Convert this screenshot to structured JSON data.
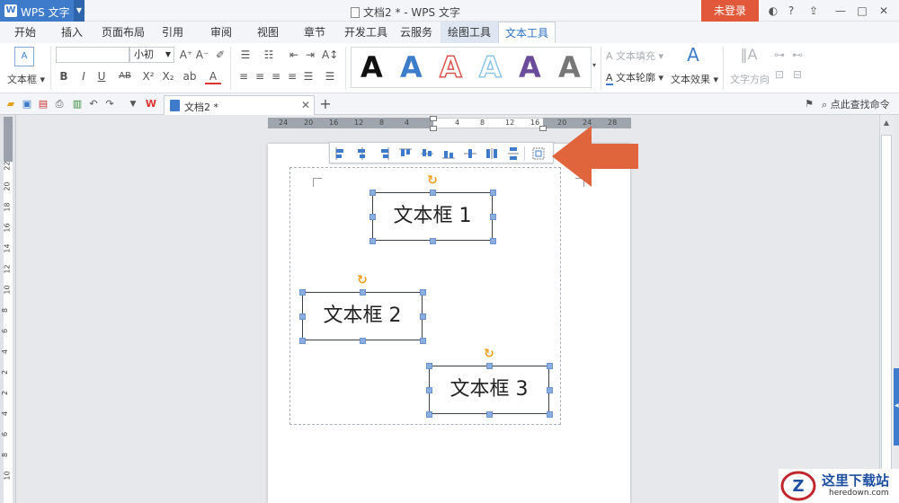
{
  "app": {
    "name": "WPS 文字",
    "doc_title": "文档2 * - WPS 文字",
    "login_label": "未登录"
  },
  "tabs": [
    "开始",
    "插入",
    "页面布局",
    "引用",
    "审阅",
    "视图",
    "章节",
    "开发工具",
    "云服务",
    "绘图工具",
    "文本工具"
  ],
  "ribbon": {
    "textbox_label": "文本框",
    "font_size": "小初",
    "font_name": "",
    "text_fill": "文本填充",
    "text_outline": "文本轮廓",
    "text_effect": "文本效果",
    "text_direction": "文字方向",
    "style_letters": [
      "A",
      "A",
      "A",
      "A",
      "A",
      "A"
    ],
    "style_colors": [
      "#111111",
      "#3d7cc9",
      "#d9534f",
      "#8fc5e8",
      "#6b4c9a",
      "#777777"
    ]
  },
  "quick_bar": {
    "doc_tab": "文档2 *",
    "search_label": "点此查找命令",
    "add_tab": "+"
  },
  "hruler_ticks": [
    "24",
    "20",
    "16",
    "12",
    "8",
    "4",
    "4",
    "8",
    "12",
    "16",
    "20",
    "24",
    "28"
  ],
  "vruler_ticks": [
    "22",
    "20",
    "18",
    "16",
    "14",
    "12",
    "10",
    "8",
    "6",
    "4",
    "2",
    "2",
    "4",
    "6",
    "8",
    "10"
  ],
  "textboxes": [
    {
      "text": "文本框 1"
    },
    {
      "text": "文本框 2"
    },
    {
      "text": "文本框 3"
    }
  ],
  "align_tools": [
    "align-left",
    "align-center",
    "align-right",
    "align-top",
    "align-middle",
    "align-bottom",
    "distribute-horizontal",
    "distribute-vertical",
    "distribute-spacing",
    "group"
  ],
  "watermark": {
    "title": "这里下载站",
    "url": "heredown.com"
  },
  "colors": {
    "accent": "#3e7ccb",
    "login": "#e1593a",
    "arrow": "#e0643c",
    "handle": "#8aaee0"
  }
}
